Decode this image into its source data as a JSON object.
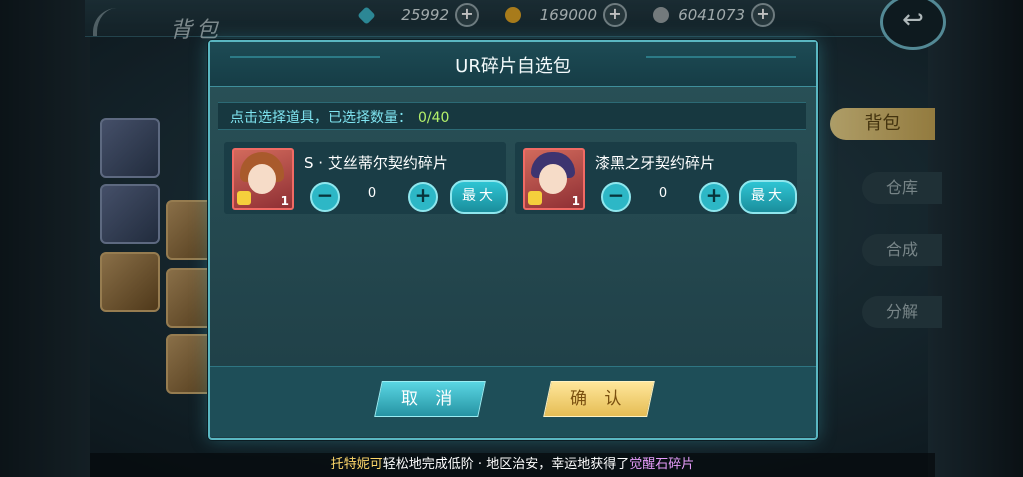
{
  "background": {
    "screen_title": "背包",
    "currencies": [
      {
        "value": "25992",
        "icon": "crystal-icon",
        "color": "#3bb4c7"
      },
      {
        "value": "169000",
        "icon": "gold-coin-icon",
        "color": "#e0a425"
      },
      {
        "value": "6041073",
        "icon": "silver-coin-icon",
        "color": "#9aa3a6"
      }
    ],
    "side_tabs": [
      "背包",
      "仓库",
      "合成",
      "分解"
    ],
    "ticker": {
      "name": "托特妮可",
      "middle": "轻松地完成低阶 · 地区治安，幸运地获得了",
      "item": "觉醒石碎片"
    }
  },
  "dialog": {
    "title": "UR碎片自选包",
    "instruction": "点击选择道具，已选择数量：",
    "selected_count": "0/40",
    "items": [
      {
        "name": "S · 艾丝蒂尔契约碎片",
        "owned": "1",
        "quantity": "0",
        "max_label": "最大"
      },
      {
        "name": "漆黑之牙契约碎片",
        "owned": "1",
        "quantity": "0",
        "max_label": "最大"
      }
    ],
    "cancel_label": "取 消",
    "confirm_label": "确 认"
  }
}
